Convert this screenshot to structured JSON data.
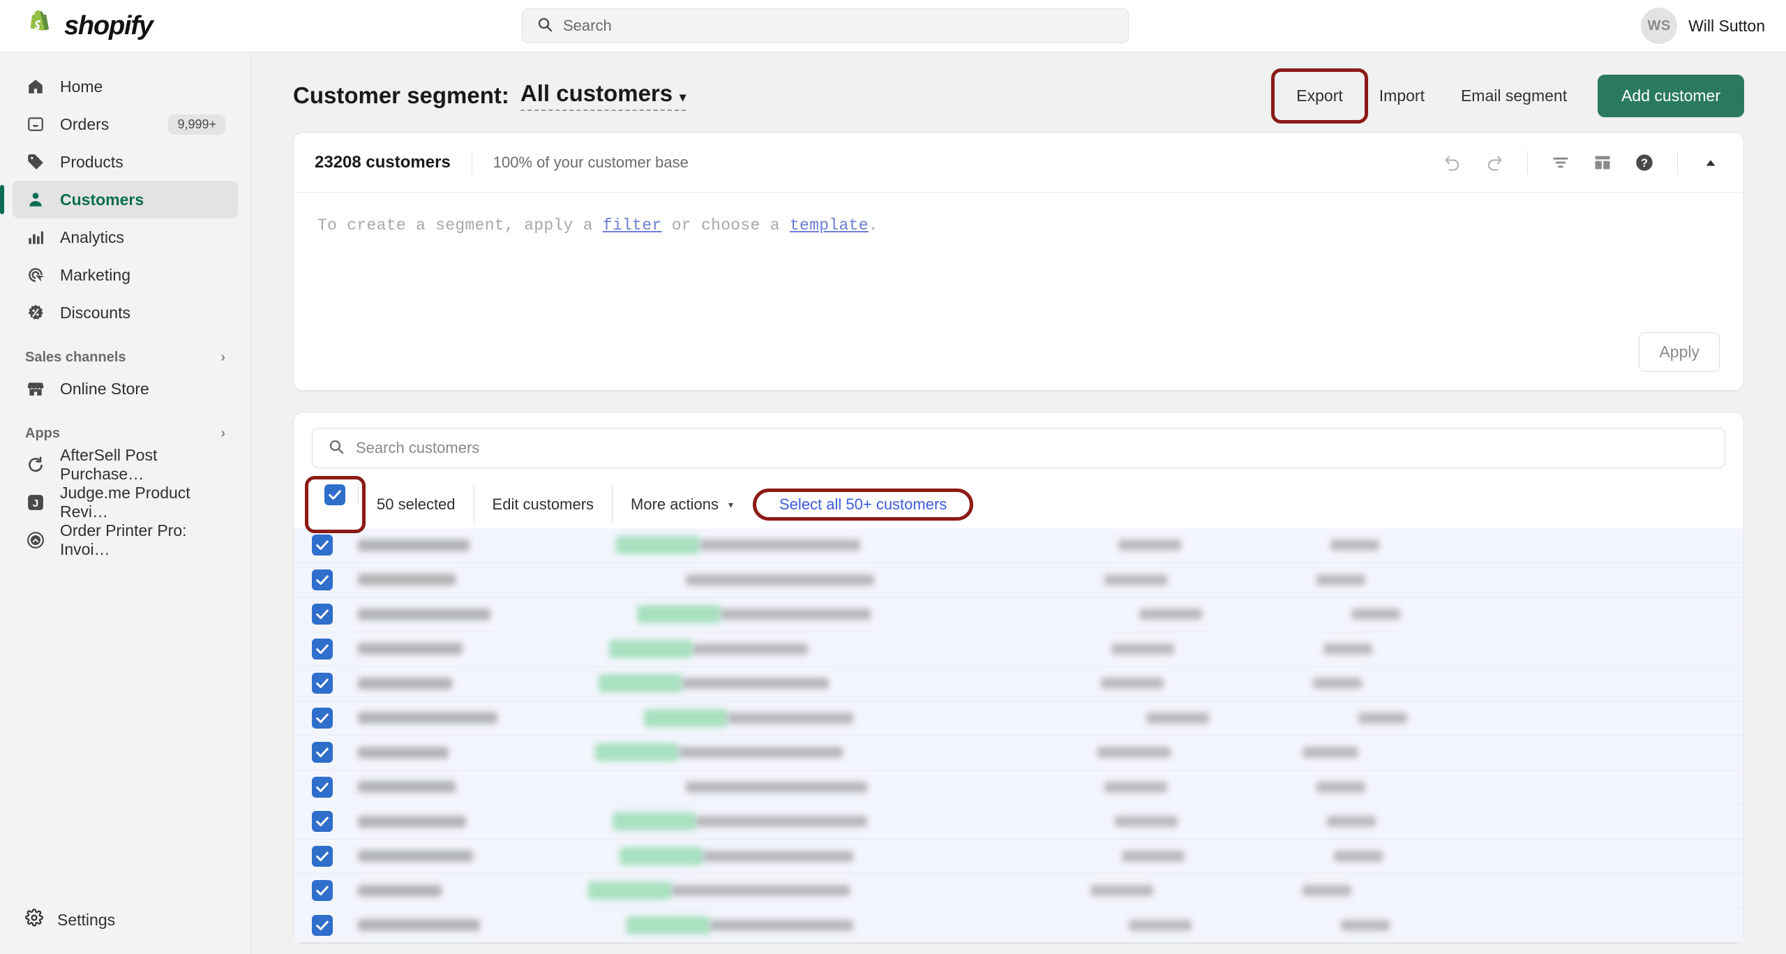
{
  "topbar": {
    "brand": "shopify",
    "brand_icon": "shopify-bag-logo",
    "search": {
      "placeholder": "Search",
      "icon": "search-icon"
    },
    "user": {
      "initials": "WS",
      "name": "Will Sutton"
    }
  },
  "sidebar": {
    "items": [
      {
        "label": "Home",
        "icon": "home-icon",
        "badge": "",
        "active": false
      },
      {
        "label": "Orders",
        "icon": "orders-inbox-icon",
        "badge": "9,999+",
        "active": false
      },
      {
        "label": "Products",
        "icon": "products-tag-icon",
        "badge": "",
        "active": false
      },
      {
        "label": "Customers",
        "icon": "customers-person-icon",
        "badge": "",
        "active": true
      },
      {
        "label": "Analytics",
        "icon": "analytics-bars-icon",
        "badge": "",
        "active": false
      },
      {
        "label": "Marketing",
        "icon": "marketing-target-icon",
        "badge": "",
        "active": false
      },
      {
        "label": "Discounts",
        "icon": "discounts-percent-icon",
        "badge": "",
        "active": false
      }
    ],
    "sales_channels": {
      "label": "Sales channels",
      "chevron": "›"
    },
    "online_store": {
      "label": "Online Store",
      "icon": "store-icon"
    },
    "apps_header": {
      "label": "Apps",
      "chevron": "›"
    },
    "apps": [
      {
        "label": "AfterSell Post Purchase…",
        "icon": "aftersell-icon"
      },
      {
        "label": "Judge.me Product Revi…",
        "icon": "judgeme-icon"
      },
      {
        "label": "Order Printer Pro: Invoi…",
        "icon": "order-printer-icon"
      }
    ],
    "settings": {
      "label": "Settings",
      "icon": "gear-icon"
    }
  },
  "page": {
    "title": "Customer segment:",
    "segment_name": "All customers",
    "segment_caret": "▾",
    "actions": {
      "export": "Export",
      "import": "Import",
      "email_segment": "Email segment",
      "add_customer": "Add customer"
    }
  },
  "segment_card": {
    "customer_count": "23208 customers",
    "percent_text": "100% of your customer base",
    "icons": [
      {
        "name": "undo-icon"
      },
      {
        "name": "redo-icon"
      },
      {
        "name": "filter-icon"
      },
      {
        "name": "template-icon"
      },
      {
        "name": "help-icon"
      },
      {
        "name": "collapse-chevron-icon"
      }
    ],
    "query": {
      "prefix": "To create a segment, apply a ",
      "link1": "filter",
      "middle": " or choose a ",
      "link2": "template",
      "suffix": "."
    },
    "apply_label": "Apply"
  },
  "list": {
    "search_placeholder": "Search customers",
    "search_icon": "search-icon",
    "bulk": {
      "checkbox_icon": "checkbox-checked-icon",
      "selected_label": "50 selected",
      "edit_label": "Edit customers",
      "more_actions_label": "More actions",
      "more_actions_caret": "▾",
      "select_all_label": "Select all 50+ customers"
    },
    "rows": [
      {
        "has_status": true,
        "name_w": 160,
        "loc_w": 230,
        "ord_w": 90,
        "amt_w": 70
      },
      {
        "has_status": false,
        "name_w": 140,
        "loc_w": 270,
        "ord_w": 90,
        "amt_w": 70
      },
      {
        "has_status": true,
        "name_w": 190,
        "loc_w": 215,
        "ord_w": 90,
        "amt_w": 70
      },
      {
        "has_status": true,
        "name_w": 150,
        "loc_w": 165,
        "ord_w": 90,
        "amt_w": 70
      },
      {
        "has_status": true,
        "name_w": 135,
        "loc_w": 210,
        "ord_w": 90,
        "amt_w": 70
      },
      {
        "has_status": true,
        "name_w": 200,
        "loc_w": 180,
        "ord_w": 90,
        "amt_w": 70
      },
      {
        "has_status": true,
        "name_w": 130,
        "loc_w": 235,
        "ord_w": 105,
        "amt_w": 80
      },
      {
        "has_status": false,
        "name_w": 140,
        "loc_w": 260,
        "ord_w": 90,
        "amt_w": 70
      },
      {
        "has_status": true,
        "name_w": 155,
        "loc_w": 245,
        "ord_w": 90,
        "amt_w": 70
      },
      {
        "has_status": true,
        "name_w": 165,
        "loc_w": 215,
        "ord_w": 90,
        "amt_w": 70
      },
      {
        "has_status": true,
        "name_w": 120,
        "loc_w": 255,
        "ord_w": 90,
        "amt_w": 70
      },
      {
        "has_status": true,
        "name_w": 175,
        "loc_w": 205,
        "ord_w": 90,
        "amt_w": 70
      }
    ]
  },
  "annotations": {
    "color": "#8b1a16"
  }
}
